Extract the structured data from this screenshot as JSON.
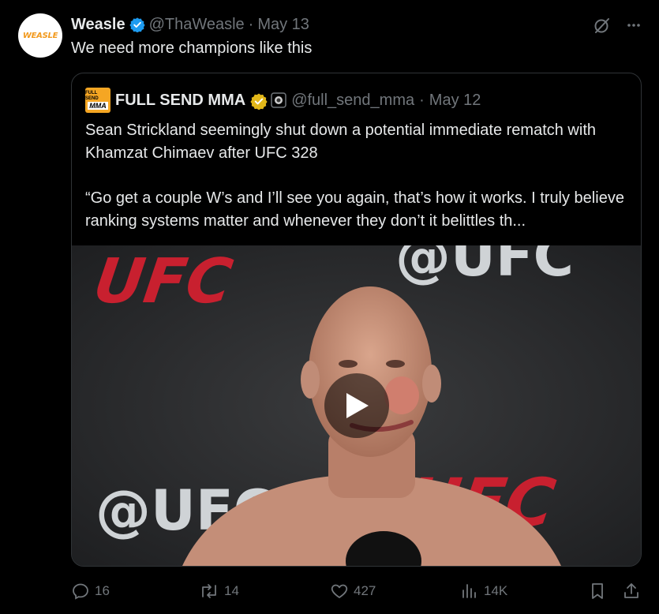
{
  "tweet": {
    "avatar_logo_text": "WEASLE",
    "author_name": "Weasle",
    "handle": "@ThaWeasle",
    "separator": "·",
    "date": "May 13",
    "text": "We need more champions like this",
    "verified_icon": "verified-badge-blue",
    "grok_icon": "grok-slash-icon",
    "more_icon": "more-dots-icon"
  },
  "quote": {
    "avatar_line1": "FULL SEND",
    "avatar_line2": "MMA",
    "author_name": "FULL SEND MMA",
    "handle": "@full_send_mma",
    "separator": "·",
    "date": "May 12",
    "verified_icon": "verified-badge-gold",
    "affiliate_icon": "affiliate-badge",
    "paragraph1": "Sean Strickland seemingly shut down a potential immediate rematch with Khamzat Chimaev after UFC 328",
    "paragraph2": "“Go get a couple W’s and I’ll see you again, that’s how it works. I truly believe ranking systems matter and whenever they don’t it belittles th...",
    "media": {
      "backdrop_texts": [
        "UFC",
        "@UFC",
        "@UFC",
        "UFC"
      ],
      "play_icon": "play-icon"
    }
  },
  "actions": {
    "replies": "16",
    "reposts": "14",
    "likes": "427",
    "views": "14K"
  },
  "colors": {
    "background": "#000000",
    "text_primary": "#e7e9ea",
    "text_secondary": "#71767b",
    "border": "#2f3336",
    "verified_blue": "#1d9bf0",
    "verified_gold": "#e2b719",
    "ufc_red": "#c8202f"
  }
}
